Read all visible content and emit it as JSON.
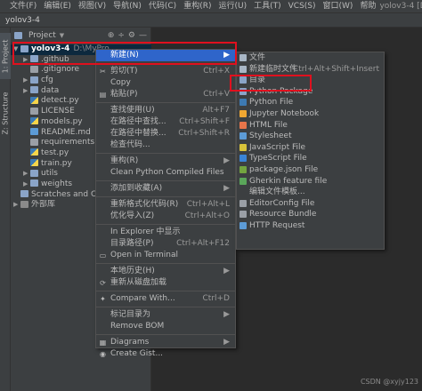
{
  "menubar": {
    "items": [
      "文件(F)",
      "编辑(E)",
      "视图(V)",
      "导航(N)",
      "代码(C)",
      "重构(R)",
      "运行(U)",
      "工具(T)",
      "VCS(S)",
      "窗口(W)",
      "帮助"
    ],
    "title": "yolov3-4 [D:\\MyPro",
    "minimize": "—",
    "close": "✕"
  },
  "navbar": {
    "breadcrumb": "yolov3-4"
  },
  "left_strip": {
    "project_tab": "1: Project",
    "structure_tab": "Z: Structure"
  },
  "project_pane": {
    "header": {
      "title": "Project",
      "tools": [
        "⊕",
        "÷",
        "⚙",
        "—"
      ]
    },
    "tree": [
      {
        "label": "yolov3-4",
        "suffix": "D:\\MyPro",
        "icon": "folder",
        "expanded": true,
        "depth": 0
      },
      {
        "label": ".github",
        "icon": "folder",
        "expanded": false,
        "depth": 1
      },
      {
        "label": ".gitignore",
        "icon": "txtfile",
        "depth": 1
      },
      {
        "label": "cfg",
        "icon": "folder",
        "expanded": false,
        "depth": 1
      },
      {
        "label": "data",
        "icon": "folder",
        "expanded": false,
        "depth": 1
      },
      {
        "label": "detect.py",
        "icon": "pyfile",
        "depth": 1
      },
      {
        "label": "LICENSE",
        "icon": "txtfile",
        "depth": 1
      },
      {
        "label": "models.py",
        "icon": "pyfile",
        "depth": 1
      },
      {
        "label": "README.md",
        "icon": "mdfile",
        "depth": 1
      },
      {
        "label": "requirements.txt",
        "icon": "txtfile",
        "depth": 1
      },
      {
        "label": "test.py",
        "icon": "pyfile",
        "depth": 1
      },
      {
        "label": "train.py",
        "icon": "pyfile",
        "depth": 1
      },
      {
        "label": "utils",
        "icon": "folder",
        "expanded": false,
        "depth": 1
      },
      {
        "label": "weights",
        "icon": "folder",
        "expanded": false,
        "depth": 1
      },
      {
        "label": "Scratches and Con",
        "icon": "folder",
        "depth": 0
      },
      {
        "label": "外部库",
        "icon": "libicon",
        "expanded": false,
        "depth": 0
      }
    ]
  },
  "context_menu": {
    "items": [
      {
        "label": "新建(N)",
        "icon": "",
        "shortcut": "▶",
        "highlight": true
      },
      {
        "sep": true
      },
      {
        "label": "剪切(T)",
        "icon": "✂",
        "shortcut": "Ctrl+X"
      },
      {
        "label": "Copy",
        "icon": "",
        "shortcut": ""
      },
      {
        "label": "粘贴(P)",
        "icon": "▤",
        "shortcut": "Ctrl+V"
      },
      {
        "sep": true
      },
      {
        "label": "查找使用(U)",
        "icon": "",
        "shortcut": "Alt+F7"
      },
      {
        "label": "在路径中查找...",
        "icon": "",
        "shortcut": "Ctrl+Shift+F"
      },
      {
        "label": "在路径中替换...",
        "icon": "",
        "shortcut": "Ctrl+Shift+R"
      },
      {
        "label": "检查代码...",
        "icon": "",
        "shortcut": ""
      },
      {
        "sep": true
      },
      {
        "label": "重构(R)",
        "icon": "",
        "shortcut": "▶"
      },
      {
        "label": "Clean Python Compiled Files",
        "icon": "",
        "shortcut": ""
      },
      {
        "sep": true
      },
      {
        "label": "添加到收藏(A)",
        "icon": "",
        "shortcut": "▶"
      },
      {
        "sep": true
      },
      {
        "label": "重新格式化代码(R)",
        "icon": "",
        "shortcut": "Ctrl+Alt+L"
      },
      {
        "label": "优化导入(Z)",
        "icon": "",
        "shortcut": "Ctrl+Alt+O"
      },
      {
        "sep": true
      },
      {
        "label": "In Explorer 中显示",
        "icon": "",
        "shortcut": ""
      },
      {
        "label": "目录路径(P)",
        "icon": "",
        "shortcut": "Ctrl+Alt+F12"
      },
      {
        "label": "Open in Terminal",
        "icon": "▭",
        "shortcut": ""
      },
      {
        "sep": true
      },
      {
        "label": "本地历史(H)",
        "icon": "",
        "shortcut": "▶"
      },
      {
        "label": "重新从磁盘加载",
        "icon": "⟳",
        "shortcut": ""
      },
      {
        "sep": true
      },
      {
        "label": "Compare With...",
        "icon": "✦",
        "shortcut": "Ctrl+D"
      },
      {
        "sep": true
      },
      {
        "label": "标记目录为",
        "icon": "",
        "shortcut": "▶"
      },
      {
        "label": "Remove BOM",
        "icon": "",
        "shortcut": ""
      },
      {
        "sep": true
      },
      {
        "label": "Diagrams",
        "icon": "▦",
        "shortcut": "▶"
      },
      {
        "label": "Create Gist...",
        "icon": "◉",
        "shortcut": ""
      }
    ]
  },
  "submenu": {
    "items": [
      {
        "label": "文件",
        "icon_color": "#a9b7c6",
        "shortcut": ""
      },
      {
        "label": "新建临时文件",
        "icon_color": "#a9b7c6",
        "shortcut": "Ctrl+Alt+Shift+Insert"
      },
      {
        "label": "目录",
        "icon_color": "#8aa4c8",
        "shortcut": ""
      },
      {
        "label": "Python Package",
        "icon_color": "#8aa4c8",
        "shortcut": ""
      },
      {
        "label": "Python File",
        "icon_color": "#3d7ab3",
        "shortcut": ""
      },
      {
        "label": "Jupyter Notebook",
        "icon_color": "#f0a732",
        "shortcut": ""
      },
      {
        "label": "HTML File",
        "icon_color": "#e8754a",
        "shortcut": ""
      },
      {
        "label": "Stylesheet",
        "icon_color": "#5c9bd6",
        "shortcut": ""
      },
      {
        "label": "JavaScript File",
        "icon_color": "#d8c33a",
        "shortcut": ""
      },
      {
        "label": "TypeScript File",
        "icon_color": "#3a84d6",
        "shortcut": ""
      },
      {
        "label": "package.json File",
        "icon_color": "#73a53f",
        "shortcut": ""
      },
      {
        "label": "Gherkin feature file",
        "icon_color": "#5aa65a",
        "shortcut": ""
      },
      {
        "label": "编辑文件模板...",
        "icon_color": "",
        "shortcut": ""
      },
      {
        "label": "EditorConfig File",
        "icon_color": "#9a9fa6",
        "shortcut": ""
      },
      {
        "label": "Resource Bundle",
        "icon_color": "#9a9fa6",
        "shortcut": ""
      },
      {
        "label": "HTTP Request",
        "icon_color": "#5c9bd6",
        "shortcut": ""
      }
    ]
  },
  "watermark": "CSDN @xyjy123"
}
